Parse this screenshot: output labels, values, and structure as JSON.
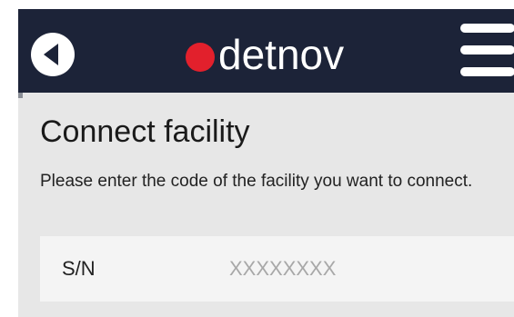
{
  "header": {
    "back_icon": "back-arrow-circle-icon",
    "logo_text": "detnov",
    "logo_dot_color": "#e2202c",
    "menu_icon": "hamburger-menu-icon",
    "background_color": "#1c2338"
  },
  "main": {
    "title": "Connect facility",
    "description": "Please enter the code of the facility you want to connect.",
    "serial_field": {
      "label": "S/N",
      "value": "",
      "placeholder": "XXXXXXXX"
    },
    "background_color": "#e7e7e7"
  }
}
